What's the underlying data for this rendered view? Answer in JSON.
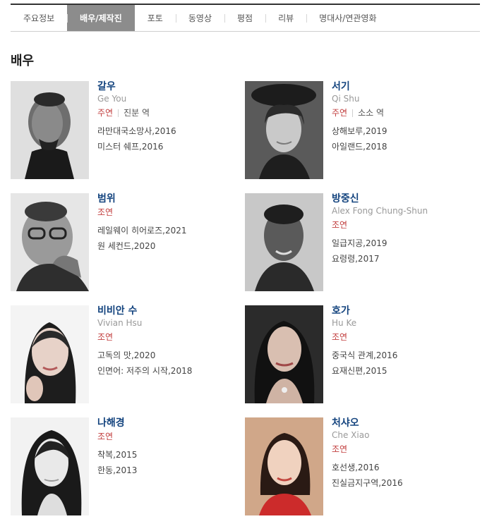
{
  "tabs": [
    {
      "label": "주요정보",
      "active": false
    },
    {
      "label": "배우/제작진",
      "active": true
    },
    {
      "label": "포토",
      "active": false
    },
    {
      "label": "동영상",
      "active": false
    },
    {
      "label": "평점",
      "active": false
    },
    {
      "label": "리뷰",
      "active": false
    },
    {
      "label": "명대사/연관영화",
      "active": false
    }
  ],
  "section_title": "배우",
  "actors": [
    {
      "name": "갈우",
      "english_name": "Ge You",
      "role": "주연",
      "character": "진분 역",
      "films": [
        "라만대국소망사,2016",
        "미스터 쉐프,2016"
      ]
    },
    {
      "name": "서기",
      "english_name": "Qi Shu",
      "role": "주연",
      "character": "소소 역",
      "films": [
        "상해보루,2019",
        "아일랜드,2018"
      ]
    },
    {
      "name": "범위",
      "english_name": "",
      "role": "조연",
      "character": "",
      "films": [
        "레일웨이 히어로즈,2021",
        "원 세컨드,2020"
      ]
    },
    {
      "name": "방중신",
      "english_name": "Alex Fong Chung-Shun",
      "role": "조연",
      "character": "",
      "films": [
        "일급지공,2019",
        "요령령,2017"
      ]
    },
    {
      "name": "비비안 수",
      "english_name": "Vivian Hsu",
      "role": "조연",
      "character": "",
      "films": [
        "고독의 맛,2020",
        "인면어: 저주의 시작,2018"
      ]
    },
    {
      "name": "호가",
      "english_name": "Hu Ke",
      "role": "조연",
      "character": "",
      "films": [
        "중국식 관계,2016",
        "요재신편,2015"
      ]
    },
    {
      "name": "나해경",
      "english_name": "",
      "role": "조연",
      "character": "",
      "films": [
        "착복,2015",
        "한동,2013"
      ]
    },
    {
      "name": "처샤오",
      "english_name": "Che Xiao",
      "role": "조연",
      "character": "",
      "films": [
        "호선생,2016",
        "진실금지구역,2016"
      ]
    }
  ]
}
